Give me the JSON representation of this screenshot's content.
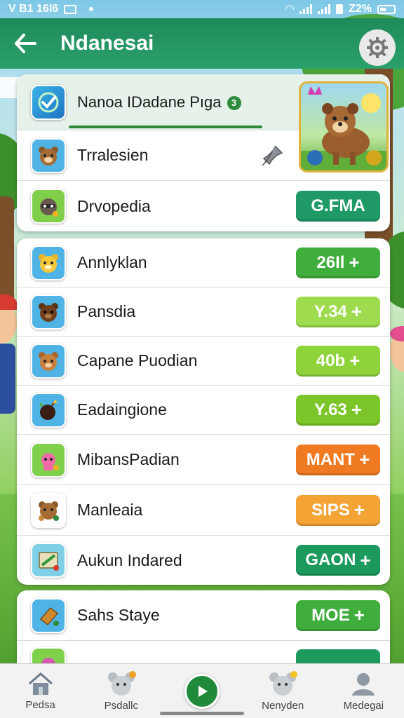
{
  "status_bar": {
    "left_text": "V B1 16I6",
    "right_text": "Z2%"
  },
  "app_bar": {
    "title": "Ndanesai"
  },
  "featured_card": {
    "title": "Nanoa IDadane Pıga",
    "badge": "3",
    "rows": [
      {
        "label": "Trralesien",
        "icon": "bear-icon"
      },
      {
        "label": "Drvopedia",
        "icon": "raccoon-icon",
        "button": "G.FMA",
        "color": "#1f9a67"
      }
    ]
  },
  "list_card": {
    "rows": [
      {
        "label": "Annlyklan",
        "icon": "yellow-bear-icon",
        "button": "26Il",
        "color": "#3fae3c"
      },
      {
        "label": "Pansdia",
        "icon": "brown-bear-icon",
        "button": "Y.34",
        "color": "#9edb4f"
      },
      {
        "label": "Capane Puodian",
        "icon": "tan-bear-icon",
        "button": "40b",
        "color": "#8fd33a"
      },
      {
        "label": "Eadaingione",
        "icon": "bomb-icon",
        "button": "Y.63",
        "color": "#7cc62a"
      },
      {
        "label": "MibansPadian",
        "icon": "pink-creature-icon",
        "button": "MANT",
        "color": "#ef7a22"
      },
      {
        "label": "Manleaia",
        "icon": "cookie-bear-icon",
        "button": "SIPS",
        "color": "#f4a335"
      },
      {
        "label": "Aukun Indared",
        "icon": "map-icon",
        "button": "GAON",
        "color": "#1c9a5e"
      }
    ]
  },
  "third_card": {
    "rows": [
      {
        "label": "Sahs Staye",
        "icon": "crate-icon",
        "button": "MOE",
        "color": "#3fae3c"
      },
      {
        "label": "",
        "icon": "pink-creature-icon",
        "button": "",
        "color": "#1c9a5e"
      }
    ]
  },
  "bottom_nav": {
    "items": [
      {
        "label": "Pedsa",
        "icon": "home-icon"
      },
      {
        "label": "Psdallc",
        "icon": "mouse-icon"
      },
      {
        "label": "",
        "icon": "play-icon"
      },
      {
        "label": "Nenyden",
        "icon": "mouse-coin-icon"
      },
      {
        "label": "Medegai",
        "icon": "profile-icon"
      }
    ]
  }
}
